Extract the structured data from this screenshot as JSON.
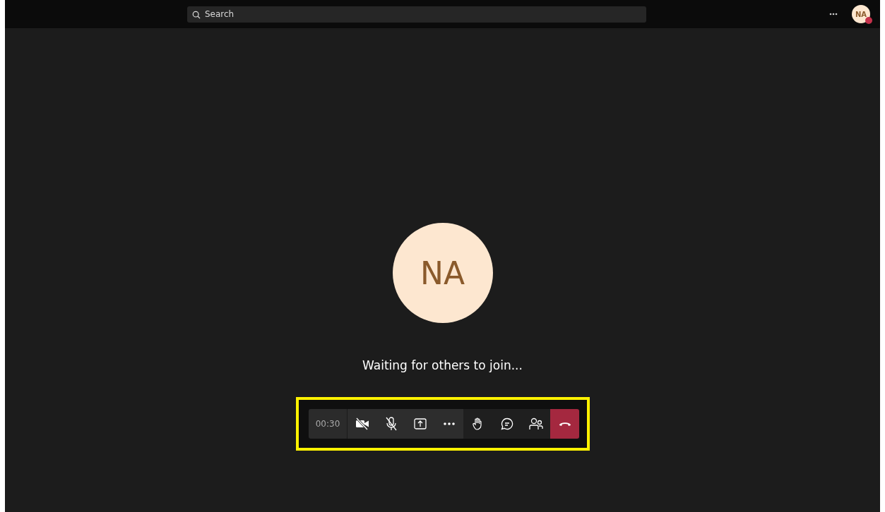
{
  "top_bar": {
    "search": {
      "placeholder": "Search"
    },
    "avatar": {
      "initials": "NA"
    }
  },
  "call": {
    "avatar": {
      "initials": "NA"
    },
    "message": "Waiting for others to join..."
  },
  "controls": {
    "timer": "00:30",
    "buttons": [
      {
        "kind": "camera-off"
      },
      {
        "kind": "mic-off"
      },
      {
        "kind": "share"
      },
      {
        "kind": "more"
      },
      {
        "kind": "hand"
      },
      {
        "kind": "chat"
      },
      {
        "kind": "people"
      },
      {
        "kind": "hangup"
      }
    ]
  }
}
